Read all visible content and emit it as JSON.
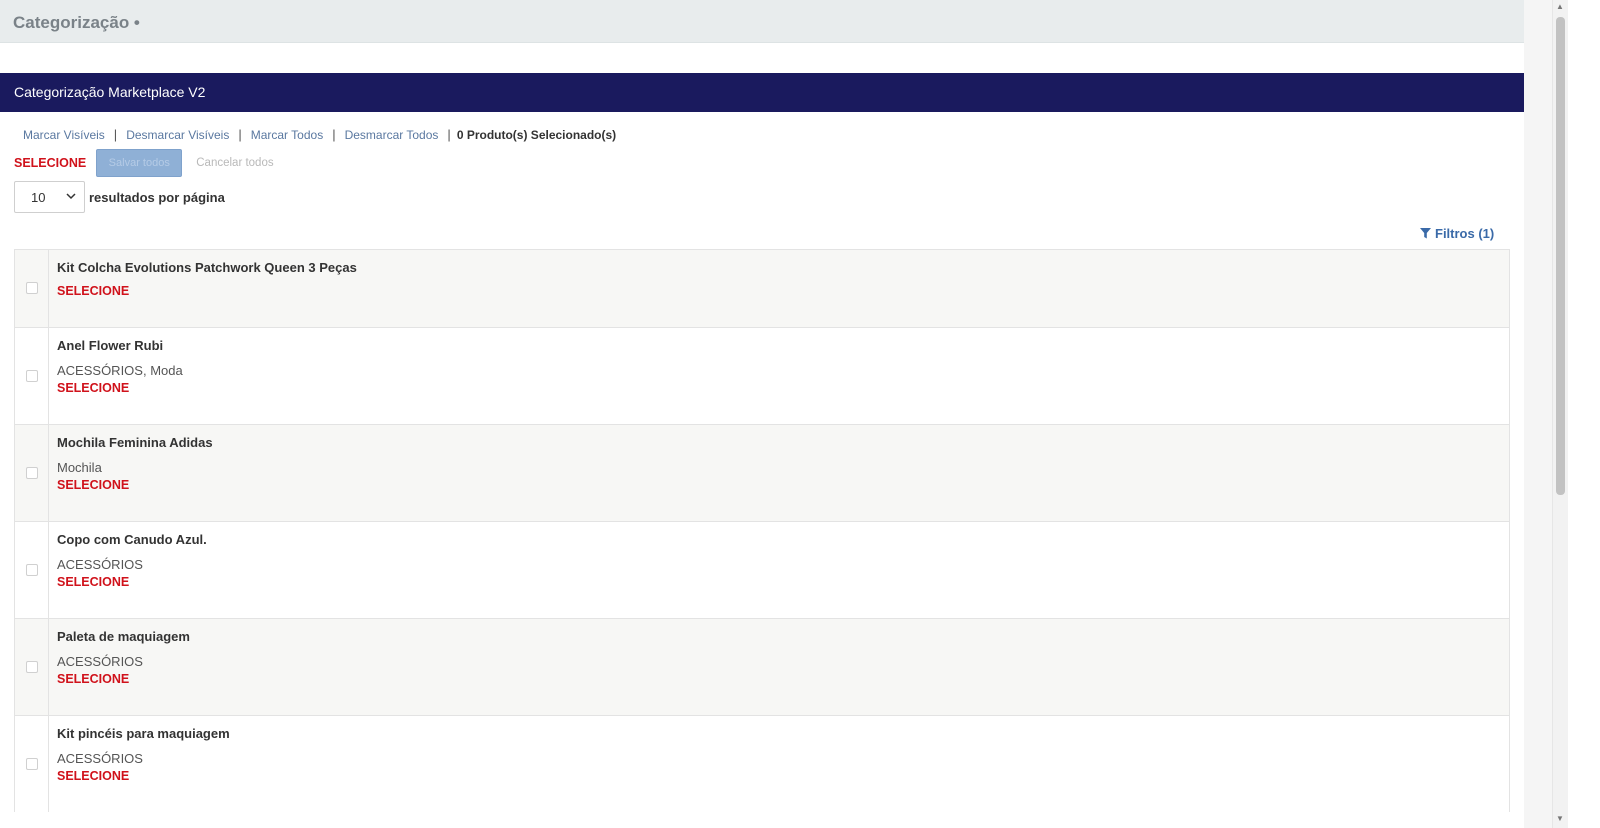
{
  "header": {
    "title": "Categorização •"
  },
  "panel": {
    "title": "Categorização Marketplace V2"
  },
  "actions": {
    "mark_visible": "Marcar Visíveis",
    "unmark_visible": "Desmarcar Visíveis",
    "mark_all": "Marcar Todos",
    "unmark_all": "Desmarcar Todos",
    "selected_count": "0 Produto(s) Selecionado(s)",
    "separator": "|"
  },
  "select_row": {
    "label": "SELECIONE",
    "apply_button": "Salvar todos",
    "cancel_all": "Cancelar todos"
  },
  "pagination": {
    "per_page_value": "10",
    "per_page_label": "resultados por página"
  },
  "filters": {
    "label": "Filtros (1)"
  },
  "products": [
    {
      "name": "Kit Colcha Evolutions Patchwork Queen 3 Peças",
      "category": "",
      "select_label": "SELECIONE"
    },
    {
      "name": "Anel Flower Rubi",
      "category": "ACESSÓRIOS, Moda",
      "select_label": "SELECIONE"
    },
    {
      "name": "Mochila Feminina Adidas",
      "category": "Mochila",
      "select_label": "SELECIONE"
    },
    {
      "name": "Copo com Canudo Azul.",
      "category": "ACESSÓRIOS",
      "select_label": "SELECIONE"
    },
    {
      "name": "Paleta de maquiagem",
      "category": "ACESSÓRIOS",
      "select_label": "SELECIONE"
    },
    {
      "name": "Kit pincéis para maquiagem",
      "category": "ACESSÓRIOS",
      "select_label": "SELECIONE"
    }
  ],
  "colors": {
    "header_bar": "#1a1a5e",
    "accent_red": "#d0121b",
    "link_blue": "#5a78a0",
    "filter_blue": "#3a6aa8"
  }
}
